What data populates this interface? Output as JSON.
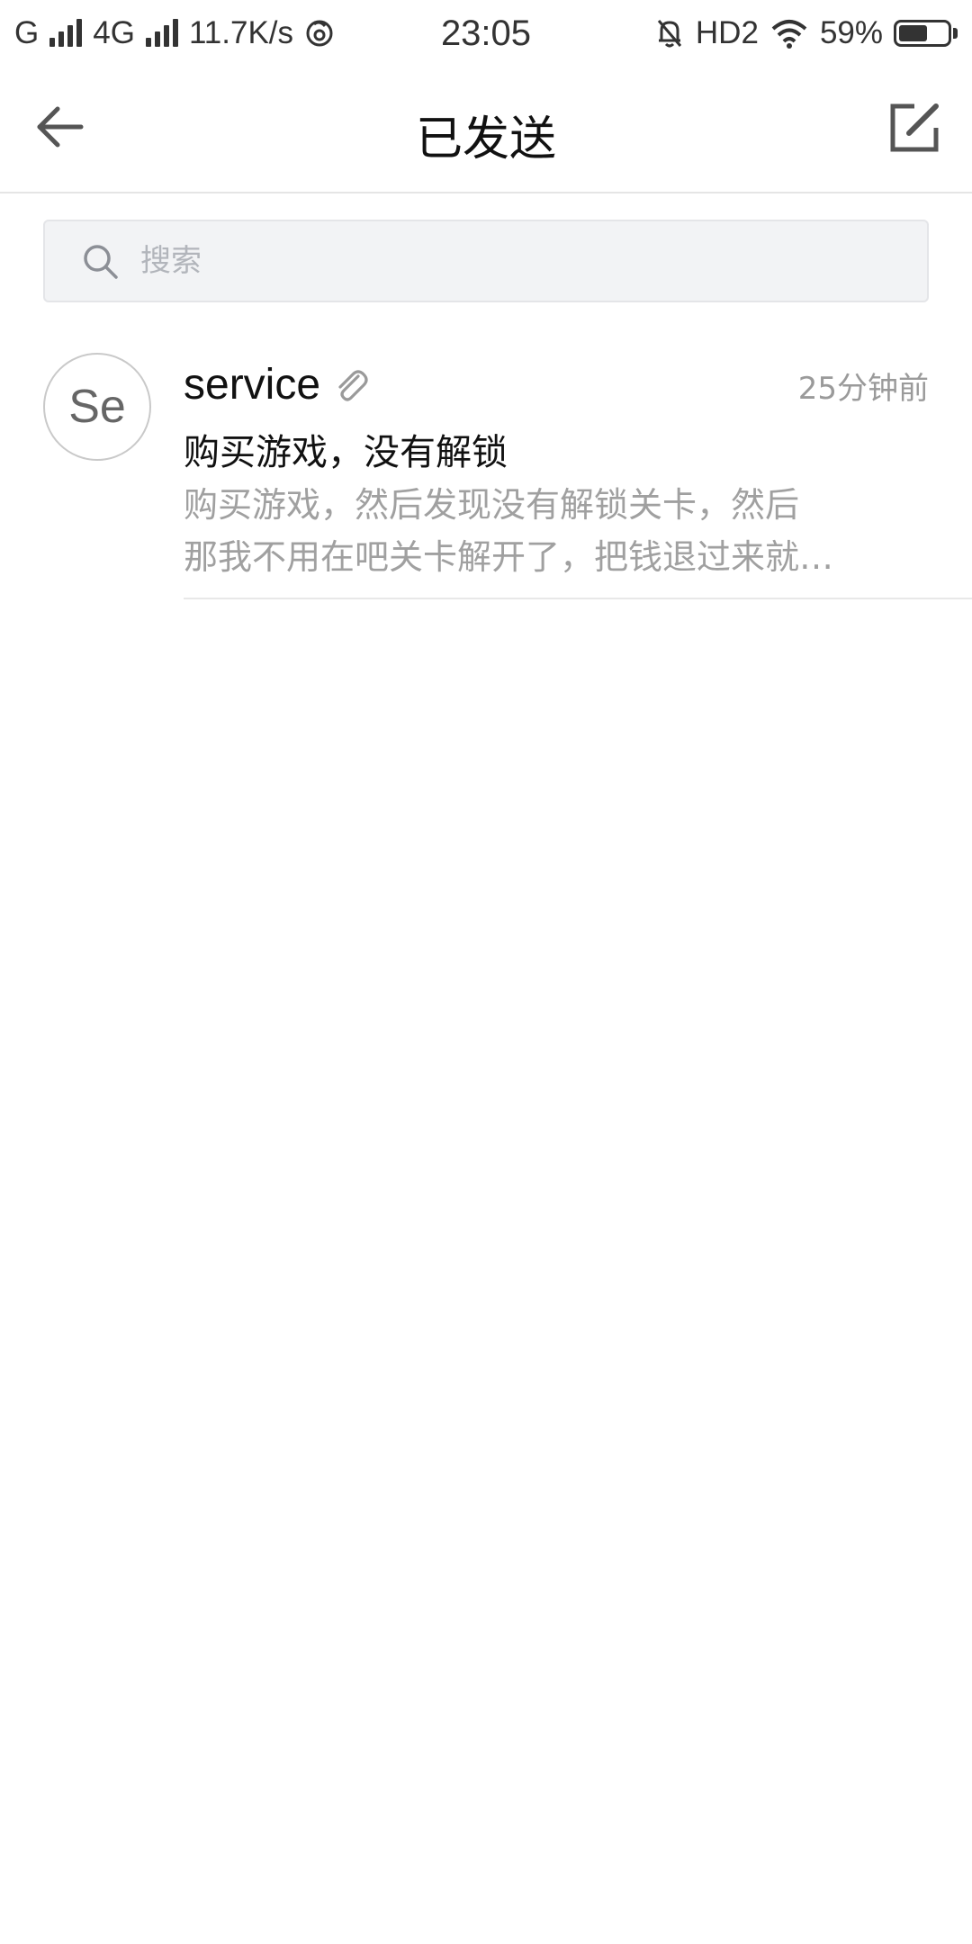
{
  "status_bar": {
    "carrier1": "G",
    "carrier2": "4G",
    "net_speed": "11.7K/s",
    "time": "23:05",
    "hd_label": "HD2",
    "battery_percent_text": "59%",
    "battery_level": 0.59
  },
  "nav": {
    "title": "已发送",
    "back_icon": "arrow-left-icon",
    "compose_icon": "compose-icon"
  },
  "search": {
    "placeholder": "搜索",
    "value": ""
  },
  "mails": [
    {
      "avatar_text": "Se",
      "sender": "service",
      "has_attachment": true,
      "time": "25分钟前",
      "subject": "购买游戏，没有解锁",
      "preview_line1": "购买游戏，然后发现没有解锁关卡，然后",
      "preview_line2": "那我不用在吧关卡解开了，把钱退过来就…"
    }
  ],
  "colors": {
    "accent_text": "#111111",
    "secondary_text": "#9a9a9a",
    "search_bg": "#f2f3f5",
    "divider": "#e5e5e5"
  }
}
